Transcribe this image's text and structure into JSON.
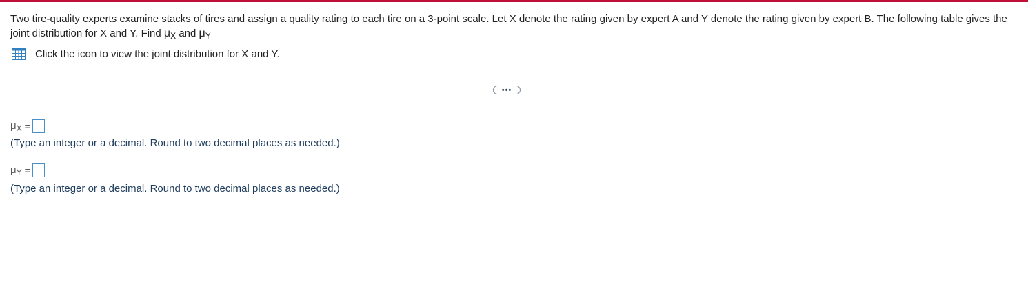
{
  "question": {
    "text": "Two tire-quality experts examine stacks of tires and assign a quality rating to each tire on a 3-point scale. Let X denote the rating given by expert A and Y denote the rating given by expert B. The following table gives the joint distribution for X and Y. Find ",
    "mu_symbol": "μ",
    "x_sub": "X",
    "and": " and ",
    "y_sub": "Y"
  },
  "table_link": {
    "icon": "table-grid-icon",
    "text": "Click the icon to view the joint distribution for X and Y."
  },
  "more_button": {
    "icon": "ellipsis-icon",
    "label": "•••"
  },
  "answers": [
    {
      "mu": "μ",
      "sub": "X",
      "equals": "=",
      "value": "",
      "hint": "(Type an integer or a decimal. Round to two decimal places as needed.)"
    },
    {
      "mu": "μ",
      "sub": "Y",
      "equals": "=",
      "value": "",
      "hint": "(Type an integer or a decimal. Round to two decimal places as needed.)"
    }
  ],
  "colors": {
    "accent_bar": "#c0103a",
    "input_border": "#4a90c8",
    "hint_text": "#1f3d5c"
  }
}
